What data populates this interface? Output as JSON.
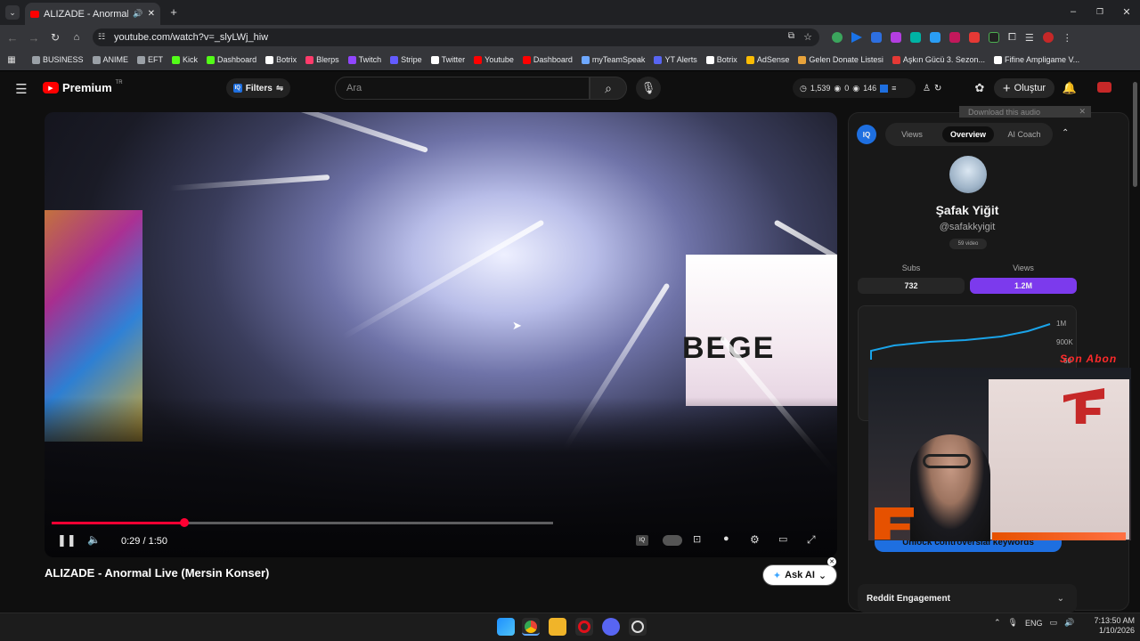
{
  "browser": {
    "tab_title": "ALIZADE - Anormal Live (M",
    "url": "youtube.com/watch?v=_slyLWj_hiw",
    "bookmarks": [
      {
        "label": "BUSINESS",
        "color": "#9aa0a6"
      },
      {
        "label": "ANIME",
        "color": "#9aa0a6"
      },
      {
        "label": "EFT",
        "color": "#9aa0a6"
      },
      {
        "label": "Kick",
        "color": "#53fc18"
      },
      {
        "label": "Dashboard",
        "color": "#53fc18"
      },
      {
        "label": "Botrix",
        "color": "#ffffff"
      },
      {
        "label": "Blerps",
        "color": "#ff3b6b"
      },
      {
        "label": "Twitch",
        "color": "#9146ff"
      },
      {
        "label": "Stripe",
        "color": "#635bff"
      },
      {
        "label": "Twitter",
        "color": "#ffffff"
      },
      {
        "label": "Youtube",
        "color": "#ff0000"
      },
      {
        "label": "Dashboard",
        "color": "#ff0000"
      },
      {
        "label": "myTeamSpeak",
        "color": "#6ea8ff"
      },
      {
        "label": "YT Alerts",
        "color": "#5865f2"
      },
      {
        "label": "Botrix",
        "color": "#ffffff"
      },
      {
        "label": "AdSense",
        "color": "#fbbc04"
      },
      {
        "label": "Gelen Donate Listesi",
        "color": "#e8a33b"
      },
      {
        "label": "Aşkın Gücü 3. Sezon...",
        "color": "#e53935"
      },
      {
        "label": "Fifine Ampligame V...",
        "color": "#ffffff"
      }
    ]
  },
  "youtube": {
    "logo": "Premium",
    "logo_region": "TR",
    "filters_label": "Filters",
    "search_placeholder": "Ara",
    "stats": {
      "likes": "1,539",
      "a": "0",
      "b": "146"
    },
    "create_label": "Oluştur"
  },
  "player": {
    "time": "0:29 / 1:50",
    "progress": 0.264,
    "stage_text": "BEGE",
    "title": "ALIZADE - Anormal Live (Mersin Konser)",
    "ask_ai": "Ask AI"
  },
  "panel": {
    "download": "Download this audio",
    "tabs": [
      "Views",
      "Overview",
      "AI Coach"
    ],
    "active_tab": "Overview",
    "channel_name": "Şafak Yiğit",
    "handle": "@safakkyigit",
    "video_count": "59 video",
    "subs_label": "Subs",
    "views_label": "Views",
    "subs_value": "732",
    "views_value": "1.2M",
    "chart_ticks": [
      "1M",
      "900K",
      "60"
    ],
    "unlock_label": "Unlock controversial keywords",
    "reddit_label": "Reddit Engagement"
  },
  "overlay": {
    "alert_text": "Son Abon"
  },
  "taskbar": {
    "lang": "ENG",
    "time": "7:13:50 AM",
    "date": "1/10/2026"
  },
  "colors": {
    "accent": "#ff0033",
    "brand": "#ff0000",
    "purple": "#7c3aed"
  }
}
